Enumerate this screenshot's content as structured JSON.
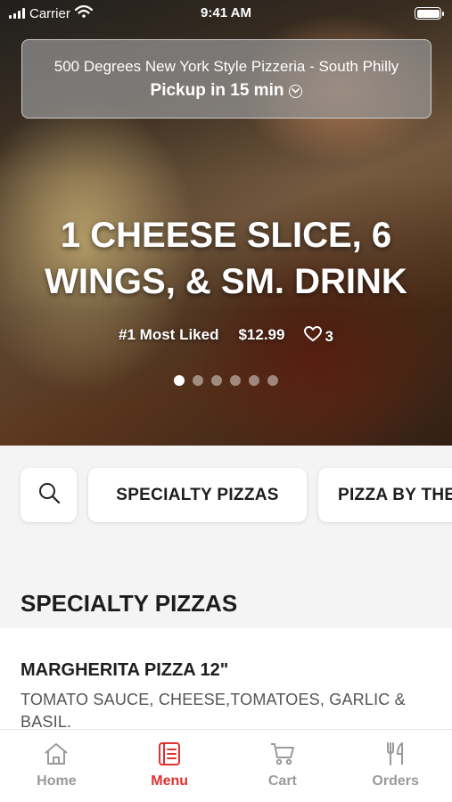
{
  "status_bar": {
    "carrier": "Carrier",
    "time": "9:41 AM"
  },
  "pickup": {
    "restaurant": "500 Degrees New York Style Pizzeria - South Philly",
    "time_label": "Pickup in 15 min"
  },
  "promo": {
    "title": "1 CHEESE SLICE, 6 WINGS, & SM. DRINK",
    "rank": "#1 Most Liked",
    "price": "$12.99",
    "likes": "3",
    "slide_count": 6,
    "active_slide": 0
  },
  "categories": {
    "search_icon": "search-icon",
    "items": [
      "SPECIALTY PIZZAS",
      "PIZZA BY THE SLICE"
    ]
  },
  "section": {
    "title": "SPECIALTY PIZZAS"
  },
  "menu_item": {
    "name": "MARGHERITA PIZZA 12\"",
    "description": "TOMATO SAUCE, CHEESE,TOMATOES, GARLIC & BASIL."
  },
  "tabs": [
    {
      "label": "Home",
      "icon": "home-icon"
    },
    {
      "label": "Menu",
      "icon": "menu-icon",
      "active": true
    },
    {
      "label": "Cart",
      "icon": "cart-icon"
    },
    {
      "label": "Orders",
      "icon": "utensils-icon"
    }
  ],
  "colors": {
    "accent": "#e0312f",
    "inactive": "#9a9a9a"
  }
}
